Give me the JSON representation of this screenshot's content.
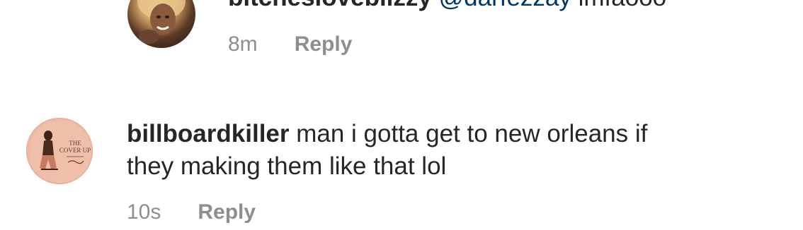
{
  "comments": [
    {
      "username": "bitcheslovebilzzy",
      "mention": "@darfezzay",
      "text": "lmfaooo",
      "time": "8m",
      "reply_label": "Reply"
    },
    {
      "username": "billboardkiller",
      "text_line1": "man i gotta get to new orleans if",
      "text_line2": "they making them like that lol",
      "time": "10s",
      "reply_label": "Reply"
    }
  ],
  "avatar2_logo": {
    "line1": "THE",
    "line2": "COVER UP"
  },
  "colors": {
    "text": "#262626",
    "muted": "#8e8e8e",
    "mention": "#00376b"
  }
}
